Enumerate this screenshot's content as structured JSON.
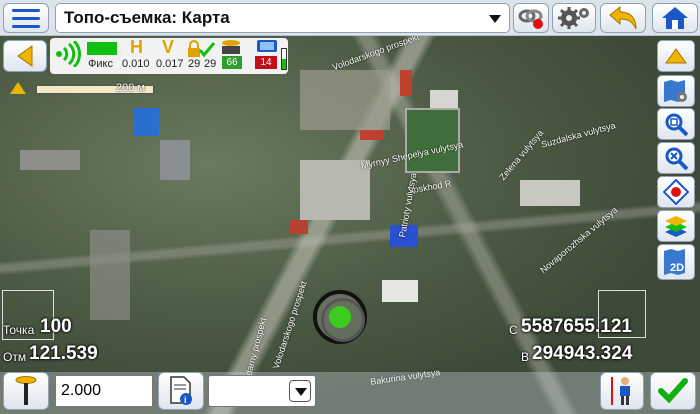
{
  "header": {
    "title": "Топо-съемка: Карта"
  },
  "status": {
    "fix_label": "Фикс",
    "h_letter": "H",
    "v_letter": "V",
    "h_value": "0.010",
    "v_value": "0.017",
    "sat_used": "29",
    "sat_visible": "29",
    "battery_receiver": "66",
    "battery_device": "14",
    "colors": {
      "fix": "#10c010",
      "letter": "#e0a400",
      "battery_ok": "#2f9e2f",
      "battery_low": "#c0101a"
    }
  },
  "map": {
    "scale_label": "200 м",
    "streets": [
      "Volodarskogo prospekt",
      "Myrnyy Shepelya vulytsya",
      "Voskhod R",
      "Patrioty vulytsya",
      "Suzdalska vulytsya",
      "Zelena vulytsya",
      "Novaporozhska vulytsya",
      "Bakurina vulytsya",
      "Voladarny prospekt",
      "Volodarskogo prospekt"
    ]
  },
  "coords": {
    "point_label": "Точка",
    "point_value": "100",
    "elev_label": "Отм",
    "elev_value": "121.539",
    "north_label": "С",
    "north_value": "5587655.121",
    "east_label": "В",
    "east_value": "294943.324"
  },
  "bottom": {
    "antenna_height": "2.000",
    "code_value": ""
  },
  "icons": [
    "menu-icon",
    "link-icon",
    "gear-icon",
    "undo-icon",
    "home-icon",
    "back-arrow-icon",
    "signal-icon",
    "lock-icon",
    "satellite-icon",
    "north-arrow-icon",
    "up-arrow-icon",
    "map-settings-icon",
    "zoom-extent-icon",
    "zoom-tool-icon",
    "target-icon",
    "layers-icon",
    "view-2d-icon",
    "range-pole-icon",
    "document-info-icon",
    "surveyor-icon",
    "checkmark-icon"
  ]
}
